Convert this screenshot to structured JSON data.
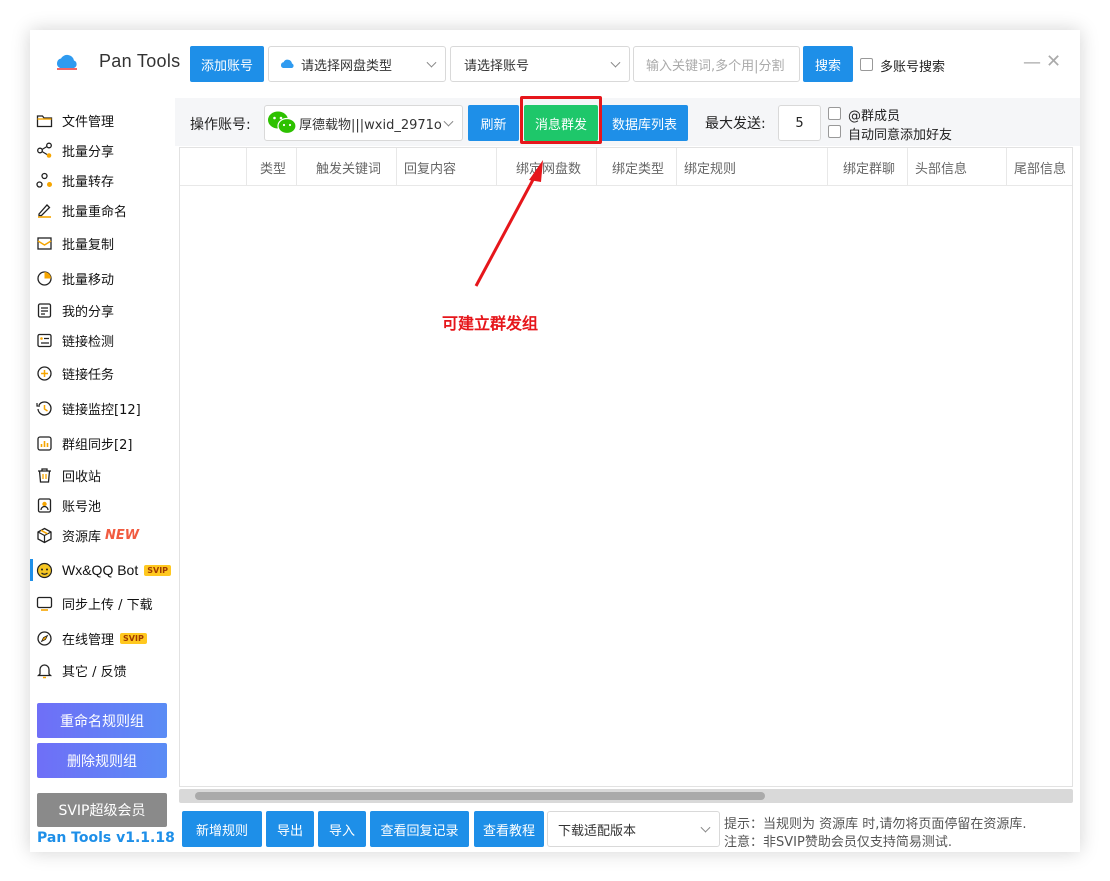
{
  "header": {
    "app_title": "Pan Tools",
    "add_account_label": "添加账号",
    "disk_type_placeholder": "请选择网盘类型",
    "account_select_placeholder": "请选择账号",
    "keyword_placeholder": "输入关键词,多个用|分割",
    "search_label": "搜索",
    "multi_account_search_label": "多账号搜索"
  },
  "toolbar": {
    "operate_account_label": "操作账号:",
    "operate_account_value": "厚德载物|||wxid_2971o",
    "refresh_label": "刷新",
    "broadcast_label": "消息群发",
    "db_list_label": "数据库列表",
    "max_send_label": "最大发送:",
    "max_send_value": "5",
    "at_members_label": "@群成员",
    "auto_accept_label": "自动同意添加好友"
  },
  "table": {
    "columns": [
      "类型",
      "触发关键词",
      "回复内容",
      "绑定网盘数",
      "绑定类型",
      "绑定规则",
      "绑定群聊",
      "头部信息",
      "尾部信息"
    ]
  },
  "sidebar": {
    "items": [
      {
        "label": "文件管理",
        "icon": "folder-icon"
      },
      {
        "label": "批量分享",
        "icon": "share-icon"
      },
      {
        "label": "批量转存",
        "icon": "transfer-icon"
      },
      {
        "label": "批量重命名",
        "icon": "rename-icon"
      },
      {
        "label": "批量复制",
        "icon": "copy-icon"
      },
      {
        "label": "批量移动",
        "icon": "move-icon"
      },
      {
        "label": "我的分享",
        "icon": "my-share-icon"
      },
      {
        "label": "链接检测",
        "icon": "link-check-icon"
      },
      {
        "label": "链接任务",
        "icon": "link-task-icon"
      },
      {
        "label": "链接监控[12]",
        "icon": "monitor-icon"
      },
      {
        "label": "群组同步[2]",
        "icon": "group-sync-icon"
      },
      {
        "label": "回收站",
        "icon": "trash-icon"
      },
      {
        "label": "账号池",
        "icon": "account-pool-icon"
      },
      {
        "label": "资源库",
        "icon": "resource-icon",
        "tag": "NEW"
      },
      {
        "label": "Wx&QQ Bot",
        "icon": "bot-icon",
        "tag": "SVIP"
      },
      {
        "label": "同步上传 / 下载",
        "icon": "sync-icon"
      },
      {
        "label": "在线管理",
        "icon": "compass-icon",
        "tag": "SVIP"
      },
      {
        "label": "其它 / 反馈",
        "icon": "bell-icon"
      }
    ],
    "rename_rule_group_label": "重命名规则组",
    "delete_rule_group_label": "删除规则组",
    "svip_label": "SVIP超级会员",
    "version_label": "Pan Tools v1.1.18"
  },
  "footer": {
    "add_rule_label": "新增规则",
    "export_label": "导出",
    "import_label": "导入",
    "view_reply_log_label": "查看回复记录",
    "view_tutorial_label": "查看教程",
    "download_version_placeholder": "下载适配版本",
    "tip_line1": "提示：当规则为 资源库 时,请勿将页面停留在资源库.",
    "tip_line2": "注意：非SVIP赞助会员仅支持简易测试."
  },
  "annotation": {
    "text": "可建立群发组"
  },
  "colors": {
    "primary": "#1e8fe8",
    "highlight_green": "#1ec76a",
    "annotation_red": "#e6161b"
  }
}
